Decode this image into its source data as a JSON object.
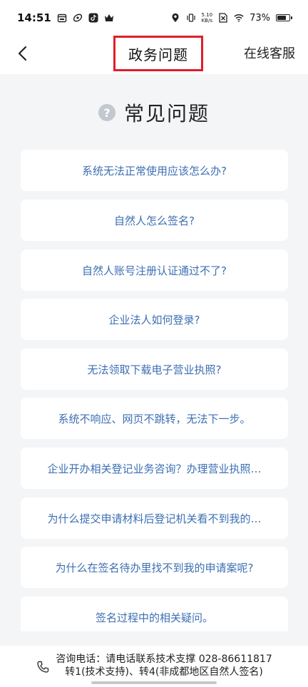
{
  "status_bar": {
    "time": "14:51",
    "net_speed_value": "5.10",
    "net_speed_unit": "KB/s",
    "battery_percent": "73%",
    "battery_level": 0.73
  },
  "nav": {
    "title": "政务问题",
    "right_label": "在线客服"
  },
  "faq": {
    "title": "常见问题",
    "items": [
      {
        "label": "系统无法正常使用应该怎么办?"
      },
      {
        "label": "自然人怎么签名?"
      },
      {
        "label": "自然人账号注册认证通过不了?"
      },
      {
        "label": "企业法人如何登录?"
      },
      {
        "label": "无法领取下载电子营业执照?"
      },
      {
        "label": "系统不响应、网页不跳转，无法下一步。"
      },
      {
        "label": "企业开办相关登记业务咨询？办理营业执照…"
      },
      {
        "label": "为什么提交申请材料后登记机关看不到我的…"
      },
      {
        "label": "为什么在签名待办里找不到我的申请案呢?"
      },
      {
        "label": "签名过程中的相关疑问。"
      }
    ]
  },
  "footer": {
    "line1": "咨询电话：请电话联系技术支撑 028-86611817",
    "line2": "转1(技术支持)、转4(非成都地区自然人签名)"
  },
  "colors": {
    "accent_link": "#3d6fb3",
    "highlight_border": "#e11d2a",
    "page_background": "#f4f5f7"
  }
}
